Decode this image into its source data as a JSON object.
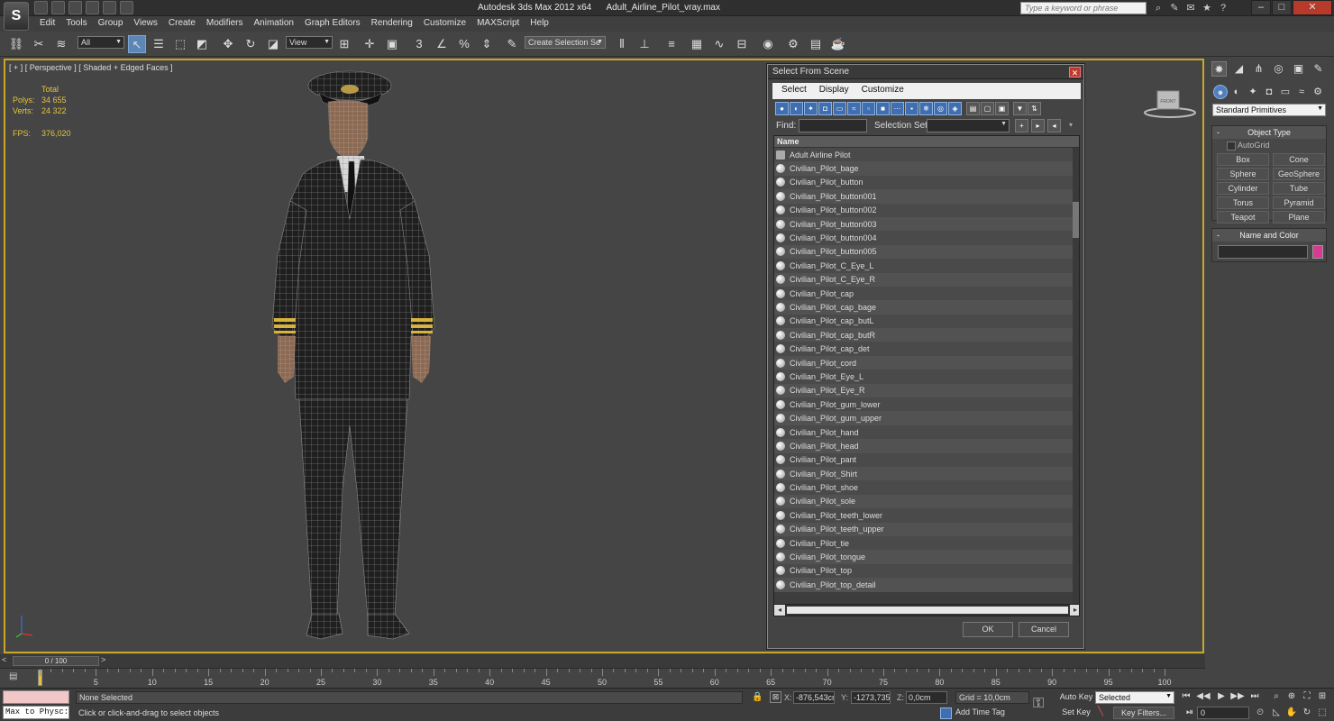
{
  "window": {
    "app_name": "Autodesk 3ds Max  2012 x64",
    "file_name": "Adult_Airline_Pilot_vray.max",
    "logo_text": "S",
    "search_placeholder": "Type a keyword or phrase"
  },
  "menu": [
    "Edit",
    "Tools",
    "Group",
    "Views",
    "Create",
    "Modifiers",
    "Animation",
    "Graph Editors",
    "Rendering",
    "Customize",
    "MAXScript",
    "Help"
  ],
  "toolbar": {
    "filter_value": "All",
    "coord_system": "View",
    "selection_set_placeholder": "Create Selection Se",
    "snap_label": "3"
  },
  "viewport": {
    "label": "[ + ] [ Perspective ] [ Shaded + Edged Faces ]",
    "stats": {
      "header": "Total",
      "polys_label": "Polys:",
      "polys": "34 655",
      "verts_label": "Verts:",
      "verts": "24 322",
      "fps_label": "FPS:",
      "fps": "376,020"
    },
    "viewcube_label": "FRONT"
  },
  "dialog": {
    "title": "Select From Scene",
    "menu": [
      "Select",
      "Display",
      "Customize"
    ],
    "find_label": "Find:",
    "find_value": "",
    "selection_set_label": "Selection Set:",
    "column_header": "Name",
    "items": [
      {
        "name": "Adult Airline Pilot",
        "type": "group"
      },
      {
        "name": "Civilian_Pilot_bage",
        "type": "object"
      },
      {
        "name": "Civilian_Pilot_button",
        "type": "object"
      },
      {
        "name": "Civilian_Pilot_button001",
        "type": "object"
      },
      {
        "name": "Civilian_Pilot_button002",
        "type": "object"
      },
      {
        "name": "Civilian_Pilot_button003",
        "type": "object"
      },
      {
        "name": "Civilian_Pilot_button004",
        "type": "object"
      },
      {
        "name": "Civilian_Pilot_button005",
        "type": "object"
      },
      {
        "name": "Civilian_Pilot_C_Eye_L",
        "type": "object"
      },
      {
        "name": "Civilian_Pilot_C_Eye_R",
        "type": "object"
      },
      {
        "name": "Civilian_Pilot_cap",
        "type": "object"
      },
      {
        "name": "Civilian_Pilot_cap_bage",
        "type": "object"
      },
      {
        "name": "Civilian_Pilot_cap_butL",
        "type": "object"
      },
      {
        "name": "Civilian_Pilot_cap_butR",
        "type": "object"
      },
      {
        "name": "Civilian_Pilot_cap_det",
        "type": "object"
      },
      {
        "name": "Civilian_Pilot_cord",
        "type": "object"
      },
      {
        "name": "Civilian_Pilot_Eye_L",
        "type": "object"
      },
      {
        "name": "Civilian_Pilot_Eye_R",
        "type": "object"
      },
      {
        "name": "Civilian_Pilot_gum_lower",
        "type": "object"
      },
      {
        "name": "Civilian_Pilot_gum_upper",
        "type": "object"
      },
      {
        "name": "Civilian_Pilot_hand",
        "type": "object"
      },
      {
        "name": "Civilian_Pilot_head",
        "type": "object"
      },
      {
        "name": "Civilian_Pilot_pant",
        "type": "object"
      },
      {
        "name": "Civilian_Pilot_Shirt",
        "type": "object"
      },
      {
        "name": "Civilian_Pilot_shoe",
        "type": "object"
      },
      {
        "name": "Civilian_Pilot_sole",
        "type": "object"
      },
      {
        "name": "Civilian_Pilot_teeth_lower",
        "type": "object"
      },
      {
        "name": "Civilian_Pilot_teeth_upper",
        "type": "object"
      },
      {
        "name": "Civilian_Pilot_tie",
        "type": "object"
      },
      {
        "name": "Civilian_Pilot_tongue",
        "type": "object"
      },
      {
        "name": "Civilian_Pilot_top",
        "type": "object"
      },
      {
        "name": "Civilian_Pilot_top_detail",
        "type": "object"
      }
    ],
    "ok_label": "OK",
    "cancel_label": "Cancel"
  },
  "command_panel": {
    "category": "Standard Primitives",
    "object_type_title": "Object Type",
    "autogrid_label": "AutoGrid",
    "objects": [
      "Box",
      "Cone",
      "Sphere",
      "GeoSphere",
      "Cylinder",
      "Tube",
      "Torus",
      "Pyramid",
      "Teapot",
      "Plane"
    ],
    "name_color_title": "Name and Color",
    "object_color": "#d83a91"
  },
  "timeline": {
    "frame_display": "0 / 100",
    "ticks": [
      "5",
      "10",
      "15",
      "20",
      "25",
      "30",
      "35",
      "40",
      "45",
      "50",
      "55",
      "60",
      "65",
      "70",
      "75",
      "80",
      "85",
      "90",
      "95",
      "100"
    ]
  },
  "status": {
    "maxscript_text": "Max to Physc:",
    "selection": "None Selected",
    "prompt": "Click or click-and-drag to select objects",
    "x_label": "X:",
    "x": "-876,543cr",
    "y_label": "Y:",
    "y": "-1273,735",
    "z_label": "Z:",
    "z": "0,0cm",
    "grid": "Grid = 10,0cm",
    "add_time_tag": "Add Time Tag",
    "auto_key": "Auto Key",
    "auto_key_mode": "Selected",
    "set_key": "Set Key",
    "key_filters": "Key Filters...",
    "current_frame": "0"
  }
}
